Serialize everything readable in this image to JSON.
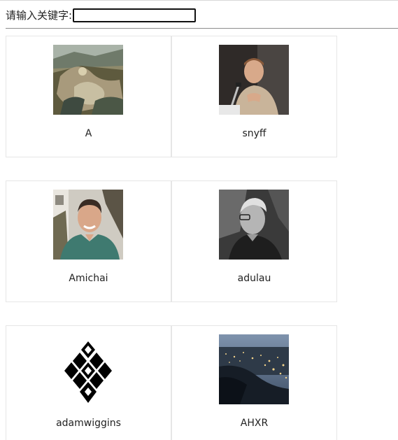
{
  "search": {
    "label": "请输入关键字:",
    "value": "",
    "placeholder": ""
  },
  "users": [
    {
      "name": "A",
      "avatar_icon": "painting-avatar-icon"
    },
    {
      "name": "snyff",
      "avatar_icon": "speaker-photo-avatar-icon"
    },
    {
      "name": "Amichai",
      "avatar_icon": "smiling-man-photo-avatar-icon"
    },
    {
      "name": "adulau",
      "avatar_icon": "grayscale-man-photo-avatar-icon"
    },
    {
      "name": "adamwiggins",
      "avatar_icon": "black-diamond-logo-avatar-icon"
    },
    {
      "name": "AHXR",
      "avatar_icon": "night-city-photo-avatar-icon"
    }
  ]
}
